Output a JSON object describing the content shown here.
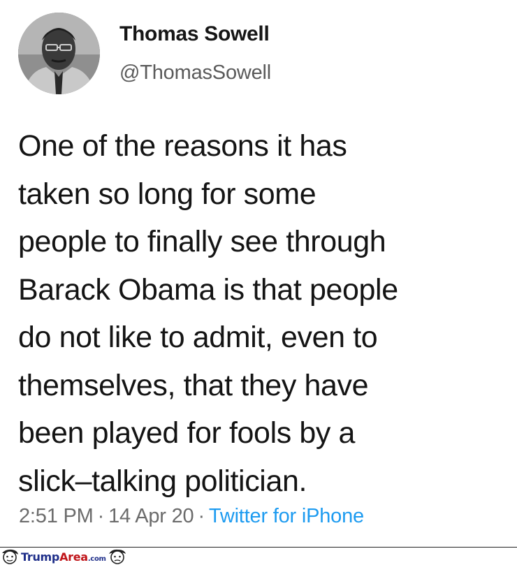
{
  "tweet": {
    "display_name": "Thomas Sowell",
    "handle": "@ThomasSowell",
    "body_lines": [
      "One of the reasons it has",
      "taken so long for some",
      "people to finally see through",
      "Barack Obama is that people",
      "do not like to admit, even to",
      "themselves, that they have",
      "been played for fools by a",
      "slick–talking politician."
    ],
    "time": "2:51 PM",
    "date": "14 Apr 20",
    "separator": "·",
    "source": "Twitter for iPhone"
  },
  "watermark": {
    "part1": "Trump",
    "part2": "Area",
    "part3": ".com"
  },
  "colors": {
    "link": "#1d9bf0",
    "watermark_blue": "#1f2f8a",
    "watermark_red": "#c0151a"
  },
  "icons": [
    "profile-avatar",
    "caricature-face-icon"
  ]
}
